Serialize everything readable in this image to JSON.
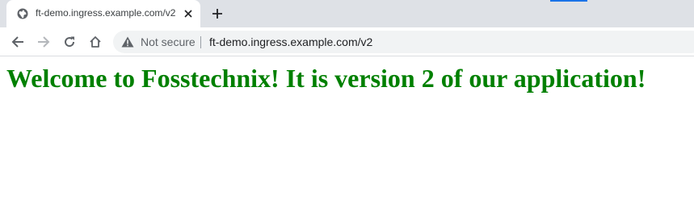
{
  "tab": {
    "title": "ft-demo.ingress.example.com/v2",
    "favicon": "globe-icon",
    "close_icon": "close-icon"
  },
  "toolbar": {
    "back_icon": "back-arrow-icon",
    "forward_icon": "forward-arrow-icon",
    "reload_icon": "reload-icon",
    "home_icon": "home-icon"
  },
  "omnibox": {
    "security_text": "Not secure",
    "url": "ft-demo.ingress.example.com/v2",
    "warning_icon": "warning-icon"
  },
  "page": {
    "heading": "Welcome to Fosstechnix! It is version 2 of our application!",
    "heading_color": "#008000"
  },
  "colors": {
    "tabstrip_bg": "#dee1e6",
    "omnibox_bg": "#f1f3f4",
    "accent": "#1a73e8"
  }
}
